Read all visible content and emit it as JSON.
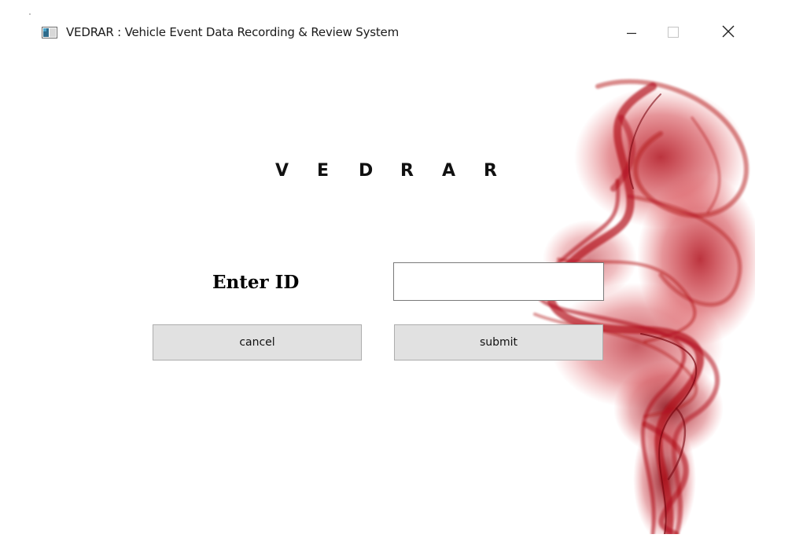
{
  "window": {
    "title": "VEDRAR : Vehicle Event Data Recording & Review System",
    "controls": {
      "minimize_icon": "minimize-icon",
      "maximize_icon": "maximize-icon",
      "close_icon": "close-icon"
    }
  },
  "main": {
    "app_title_letters": [
      "V",
      "E",
      "D",
      "R",
      "A",
      "R"
    ],
    "id_label": "Enter ID",
    "id_input": {
      "value": "",
      "placeholder": ""
    },
    "cancel_label": "cancel",
    "submit_label": "submit"
  },
  "colors": {
    "background": "#ffffff",
    "button_bg": "#e1e1e1",
    "button_border": "#adadad",
    "smoke_red": "#c8141e"
  }
}
